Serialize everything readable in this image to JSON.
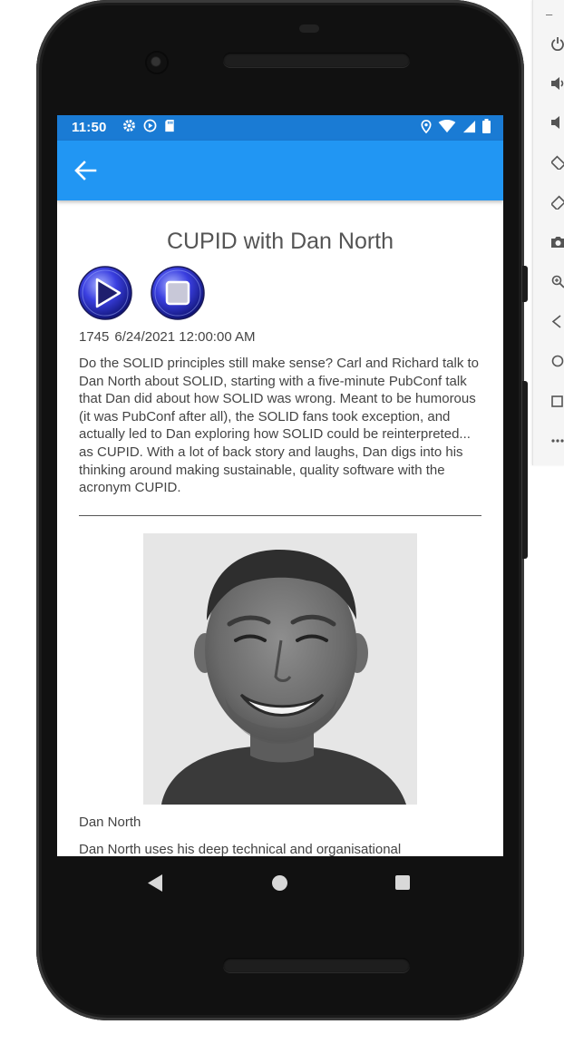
{
  "status_bar": {
    "time": "11:50",
    "left_icons": [
      "gear-icon",
      "play-circle-icon",
      "sd-card-icon"
    ],
    "right_icons": [
      "location-icon",
      "wifi-icon",
      "signal-icon",
      "battery-icon"
    ]
  },
  "app_bar": {
    "back_icon": "arrow-left-icon",
    "color": "#2196f3",
    "status_color": "#1a7bd4"
  },
  "episode": {
    "title": "CUPID with Dan North",
    "number": "1745",
    "date": "6/24/2021 12:00:00 AM",
    "description": "Do the SOLID principles still make sense? Carl and Richard talk to Dan North about SOLID, starting with a five-minute PubConf talk that Dan did about how SOLID was wrong. Meant to be humorous (it was PubConf after all), the SOLID fans took exception, and actually led to Dan exploring how SOLID could be reinterpreted... as CUPID. With a lot of back story and laughs, Dan digs into his thinking around making sustainable, quality software with the acronym CUPID.",
    "guest_name": "Dan North",
    "guest_bio": "Dan North uses his deep technical and organisational"
  },
  "media_controls": {
    "play_icon": "play-icon",
    "stop_icon": "stop-icon"
  },
  "nav_bar": {
    "back": "triangle-back-icon",
    "home": "circle-home-icon",
    "recents": "square-recents-icon"
  },
  "emulator_toolbar": {
    "items": [
      "power-icon",
      "volume-up-icon",
      "volume-down-icon",
      "rotate-left-icon",
      "rotate-right-icon",
      "camera-icon",
      "zoom-icon",
      "back-icon",
      "home-icon",
      "overview-icon",
      "more-icon"
    ]
  }
}
